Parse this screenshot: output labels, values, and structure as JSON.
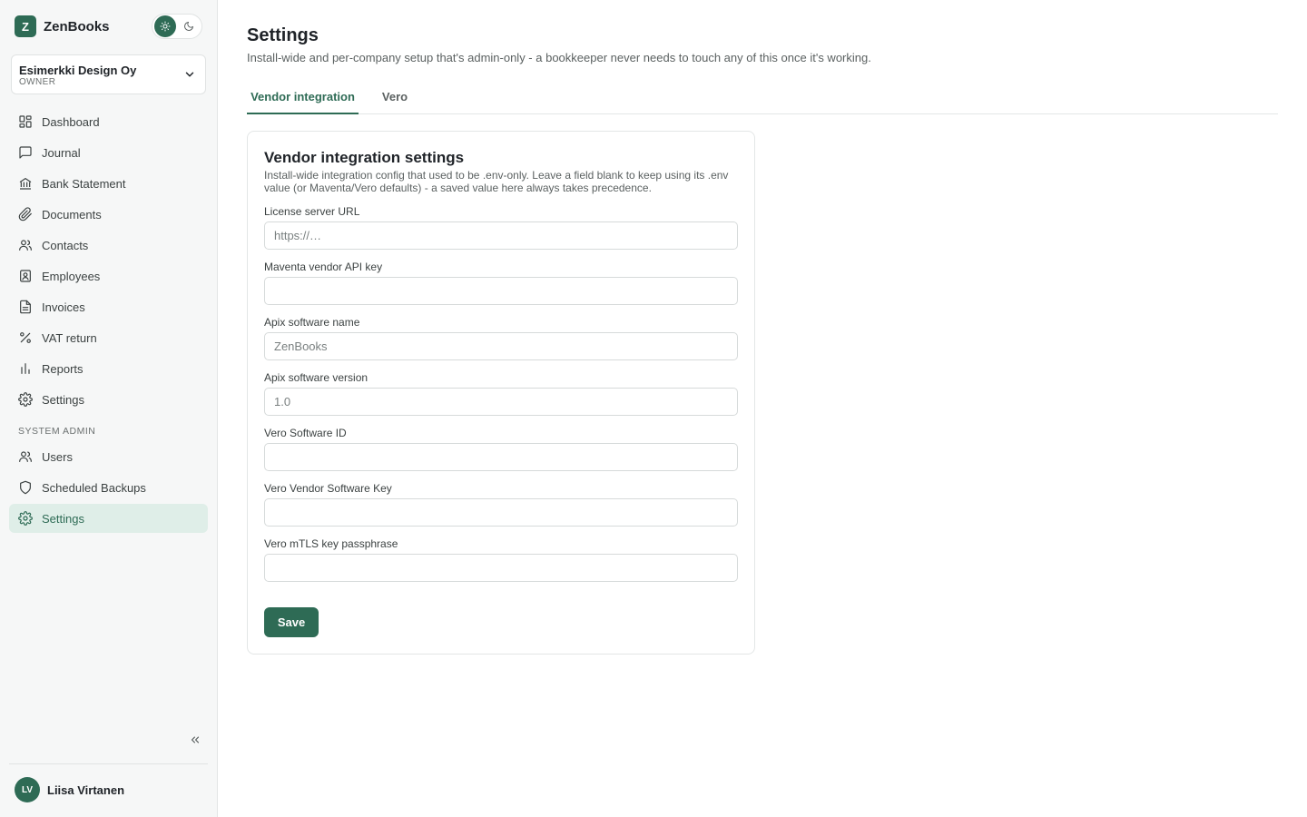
{
  "brand": {
    "logo_letter": "Z",
    "name": "ZenBooks"
  },
  "theme_toggle": {
    "light_icon": "sun-icon",
    "dark_icon": "moon-icon",
    "active": "light"
  },
  "company": {
    "name": "Esimerkki Design Oy",
    "role": "OWNER"
  },
  "nav": {
    "items": [
      {
        "label": "Dashboard",
        "icon": "dashboard-icon"
      },
      {
        "label": "Journal",
        "icon": "message-square-icon"
      },
      {
        "label": "Bank Statement",
        "icon": "bank-icon"
      },
      {
        "label": "Documents",
        "icon": "paperclip-icon"
      },
      {
        "label": "Contacts",
        "icon": "users-icon"
      },
      {
        "label": "Employees",
        "icon": "id-badge-icon"
      },
      {
        "label": "Invoices",
        "icon": "file-text-icon"
      },
      {
        "label": "VAT return",
        "icon": "percent-icon"
      },
      {
        "label": "Reports",
        "icon": "bar-chart-icon"
      },
      {
        "label": "Settings",
        "icon": "gear-icon"
      }
    ],
    "admin_section_label": "SYSTEM ADMIN",
    "admin_items": [
      {
        "label": "Users",
        "icon": "users-icon"
      },
      {
        "label": "Scheduled Backups",
        "icon": "shield-icon"
      },
      {
        "label": "Settings",
        "icon": "gear-icon",
        "active": true
      }
    ]
  },
  "user": {
    "initials": "LV",
    "name": "Liisa Virtanen"
  },
  "page": {
    "title": "Settings",
    "subtitle": "Install-wide and per-company setup that's admin-only - a bookkeeper never needs to touch any of this once it's working."
  },
  "tabs": [
    {
      "label": "Vendor integration",
      "active": true
    },
    {
      "label": "Vero",
      "active": false
    }
  ],
  "card": {
    "title": "Vendor integration settings",
    "description": "Install-wide integration config that used to be .env-only. Leave a field blank to keep using its .env value (or Maventa/Vero defaults) - a saved value here always takes precedence.",
    "fields": [
      {
        "label": "License server URL",
        "value": "",
        "placeholder": "https://…"
      },
      {
        "label": "Maventa vendor API key",
        "value": "",
        "placeholder": ""
      },
      {
        "label": "Apix software name",
        "value": "",
        "placeholder": "ZenBooks"
      },
      {
        "label": "Apix software version",
        "value": "",
        "placeholder": "1.0"
      },
      {
        "label": "Vero Software ID",
        "value": "",
        "placeholder": ""
      },
      {
        "label": "Vero Vendor Software Key",
        "value": "",
        "placeholder": ""
      },
      {
        "label": "Vero mTLS key passphrase",
        "value": "",
        "placeholder": ""
      }
    ],
    "save_label": "Save"
  },
  "colors": {
    "accent": "#2e6b55",
    "active_bg": "#dfeee8",
    "sidebar_bg": "#f6f7f7"
  }
}
